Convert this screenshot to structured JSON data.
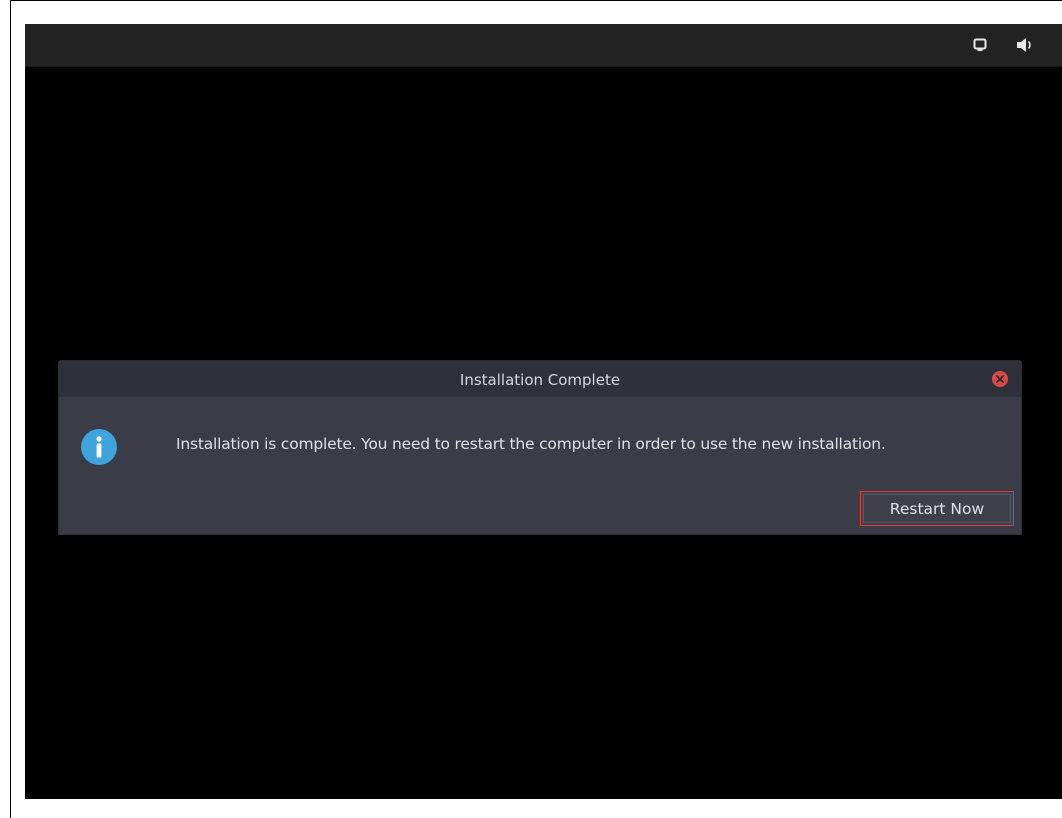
{
  "topbar": {
    "icons": [
      "display-icon",
      "volume-icon"
    ]
  },
  "dialog": {
    "title": "Installation Complete",
    "message": "Installation is complete. You need to restart the computer in order to use the new installation.",
    "icon": "info-icon",
    "primary_button_label": "Restart Now"
  },
  "colors": {
    "screen_bg": "#000000",
    "topbar_bg": "#232323",
    "dialog_bg": "#3a3d48",
    "titlebar_bg": "#2e313a",
    "close_button": "#d84a4a",
    "info_icon": "#3fa4dd",
    "highlight_border": "#e53935"
  }
}
